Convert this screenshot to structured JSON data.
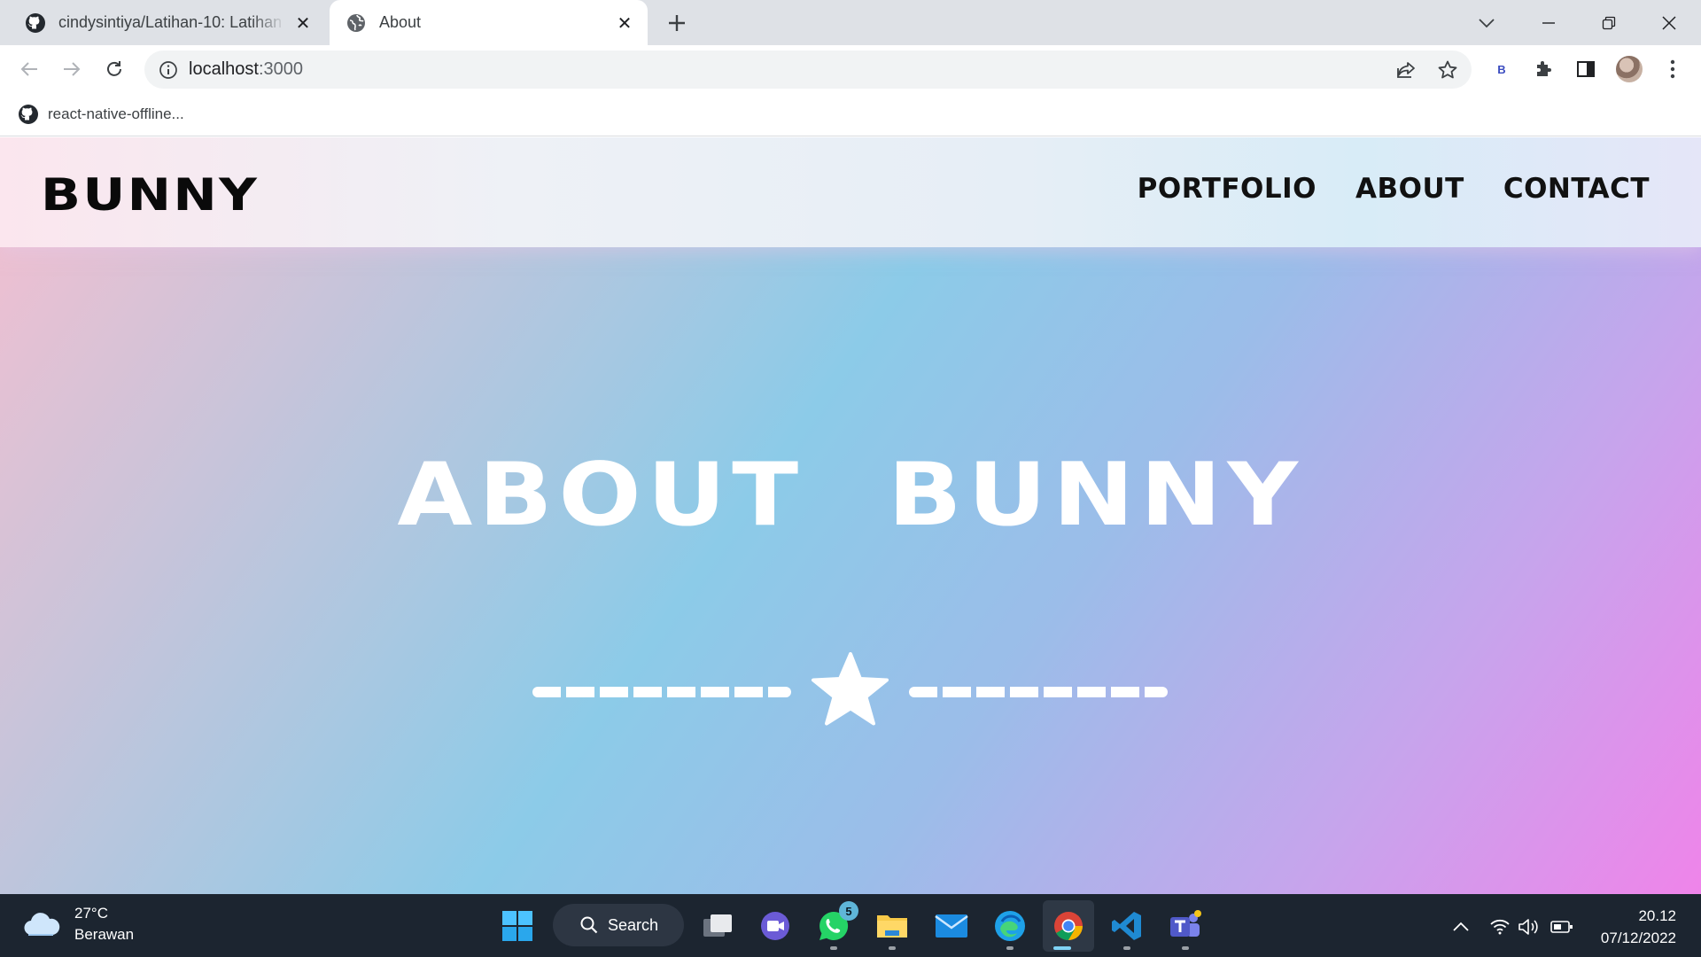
{
  "browser": {
    "tabs": [
      {
        "title": "cindysintiya/Latihan-10: Latihan M",
        "favicon": "github-icon",
        "active": false
      },
      {
        "title": "About",
        "favicon": "globe-icon",
        "active": true
      }
    ],
    "address": {
      "host": "localhost",
      "port": ":3000"
    },
    "extension_label": "B",
    "bookmarks": [
      {
        "label": "react-native-offline...",
        "favicon": "github-icon"
      }
    ]
  },
  "site": {
    "logo": "BUNNY",
    "menu": [
      "PORTFOLIO",
      "ABOUT",
      "CONTACT"
    ],
    "hero_title": "ABOUT BUNNY",
    "divider_icon": "star-icon"
  },
  "taskbar": {
    "weather": {
      "temp": "27°C",
      "condition": "Berawan"
    },
    "search_label": "Search",
    "whatsapp_badge": "5",
    "clock": {
      "time": "20.12",
      "date": "07/12/2022"
    },
    "apps": [
      "start-icon",
      "task-view-icon",
      "meet-icon",
      "whatsapp-icon",
      "file-explorer-icon",
      "mail-icon",
      "edge-icon",
      "chrome-icon",
      "vscode-icon",
      "teams-icon"
    ]
  },
  "colors": {
    "tabstrip": "#dee1e6",
    "taskbar": "#1c2530",
    "gradient_start": "#f5bfd0",
    "gradient_mid": "#8ccbe8",
    "gradient_end": "#ef84ea"
  }
}
